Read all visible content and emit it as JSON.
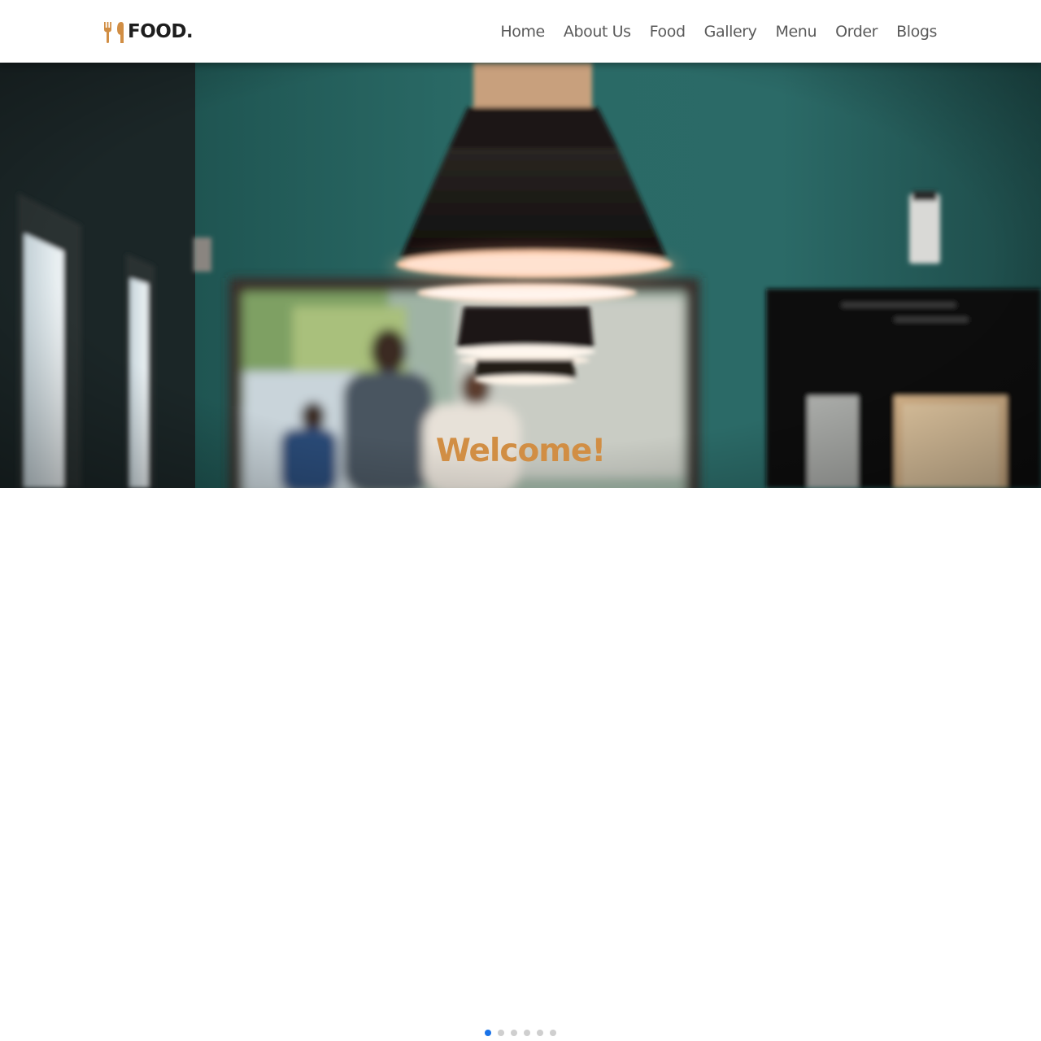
{
  "brand": {
    "name": "FOOD.",
    "accent": "#d18e44"
  },
  "nav": {
    "items": [
      {
        "label": "Home"
      },
      {
        "label": "About Us"
      },
      {
        "label": "Food"
      },
      {
        "label": "Gallery"
      },
      {
        "label": "Menu"
      },
      {
        "label": "Order"
      },
      {
        "label": "Blogs"
      }
    ]
  },
  "hero": {
    "heading": "Welcome!",
    "image": "restaurant-interior-pendant-lamps"
  },
  "slider": {
    "total": 6,
    "active_index": 0,
    "active_color": "#1a73e8",
    "inactive_color": "#cfcfcf"
  }
}
